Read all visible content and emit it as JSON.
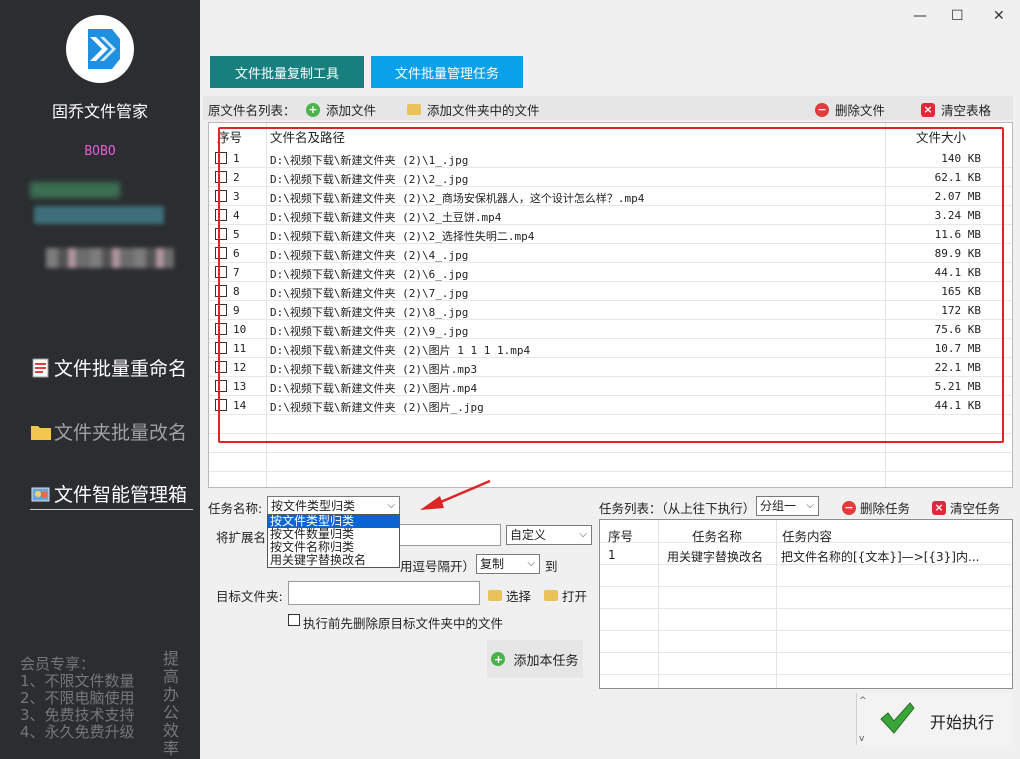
{
  "app": {
    "name": "固乔文件管家",
    "user": "BOBO"
  },
  "sidebar": {
    "items": [
      {
        "label": "文件批量重命名",
        "icon": "document-icon"
      },
      {
        "label": "文件夹批量改名",
        "icon": "folder-icon"
      },
      {
        "label": "文件智能管理箱",
        "icon": "manager-icon"
      }
    ],
    "promo_lines": [
      "会员专享：",
      "1、不限文件数量",
      "2、不限电脑使用",
      "3、免费技术支持",
      "4、永久免费升级"
    ],
    "promo_vertical": "提高办公效率"
  },
  "window": {
    "minimize": "—",
    "maximize": "☐",
    "close": "✕"
  },
  "tabs": [
    {
      "label": "文件批量复制工具",
      "color": "#17807f"
    },
    {
      "label": "文件批量管理任务",
      "color": "#0aa0ea"
    }
  ],
  "toolbar": {
    "source_label": "原文件名列表：",
    "add_file": "添加文件",
    "add_folder": "添加文件夹中的文件",
    "delete_file": "删除文件",
    "clear_table": "清空表格"
  },
  "file_table": {
    "headers": [
      "序号",
      "文件名及路径",
      "文件大小"
    ],
    "rows": [
      {
        "no": "1",
        "path": "D:\\视频下载\\新建文件夹 (2)\\1_.jpg",
        "size": "140 KB"
      },
      {
        "no": "2",
        "path": "D:\\视频下载\\新建文件夹 (2)\\2_.jpg",
        "size": "62.1 KB"
      },
      {
        "no": "3",
        "path": "D:\\视频下载\\新建文件夹 (2)\\2_商场安保机器人，这个设计怎么样？.mp4",
        "size": "2.07 MB"
      },
      {
        "no": "4",
        "path": "D:\\视频下载\\新建文件夹 (2)\\2_土豆饼.mp4",
        "size": "3.24 MB"
      },
      {
        "no": "5",
        "path": "D:\\视频下载\\新建文件夹 (2)\\2_选择性失明二.mp4",
        "size": "11.6 MB"
      },
      {
        "no": "6",
        "path": "D:\\视频下载\\新建文件夹 (2)\\4_.jpg",
        "size": "89.9 KB"
      },
      {
        "no": "7",
        "path": "D:\\视频下载\\新建文件夹 (2)\\6_.jpg",
        "size": "44.1 KB"
      },
      {
        "no": "8",
        "path": "D:\\视频下载\\新建文件夹 (2)\\7_.jpg",
        "size": "165 KB"
      },
      {
        "no": "9",
        "path": "D:\\视频下载\\新建文件夹 (2)\\8_.jpg",
        "size": "172 KB"
      },
      {
        "no": "10",
        "path": "D:\\视频下载\\新建文件夹 (2)\\9_.jpg",
        "size": "75.6 KB"
      },
      {
        "no": "11",
        "path": "D:\\视频下载\\新建文件夹 (2)\\图片 1 1 1 1.mp4",
        "size": "10.7 MB"
      },
      {
        "no": "12",
        "path": "D:\\视频下载\\新建文件夹 (2)\\图片.mp3",
        "size": "22.1 MB"
      },
      {
        "no": "13",
        "path": "D:\\视频下载\\新建文件夹 (2)\\图片.mp4",
        "size": "5.21 MB"
      },
      {
        "no": "14",
        "path": "D:\\视频下载\\新建文件夹 (2)\\图片_.jpg",
        "size": "44.1 KB"
      }
    ]
  },
  "task_form": {
    "task_name_label": "任务名称:",
    "task_name_value": "按文件类型归类",
    "dropdown_options": [
      "按文件类型归类",
      "按文件数量归类",
      "按文件名称归类",
      "用关键字替换改名"
    ],
    "ext_label": "将扩展名",
    "custom_value": "自定义",
    "comma_hint": "用逗号隔开）",
    "copy_value": "复制",
    "to_label": "到",
    "target_label": "目标文件夹:",
    "choose_button": "选择",
    "open_button": "打开",
    "delete_before_label": "执行前先删除原目标文件夹中的文件",
    "add_task_button": "添加本任务"
  },
  "task_list": {
    "label": "任务列表：（从上往下执行）",
    "group_value": "分组一",
    "delete_task": "删除任务",
    "clear_tasks": "清空任务",
    "headers": [
      "序号",
      "任务名称",
      "任务内容"
    ],
    "rows": [
      {
        "no": "1",
        "name": "用关键字替换改名",
        "content": "把文件名称的[{文本}]—>[{3}]内..."
      }
    ]
  },
  "start_button": "开始执行",
  "colors": {
    "sidebar_bg": "#2b2d30",
    "tab_primary": "#17807f",
    "tab_active": "#0aa0ea",
    "highlight_red": "#e02424",
    "accent_purple": "#e05fd0"
  }
}
